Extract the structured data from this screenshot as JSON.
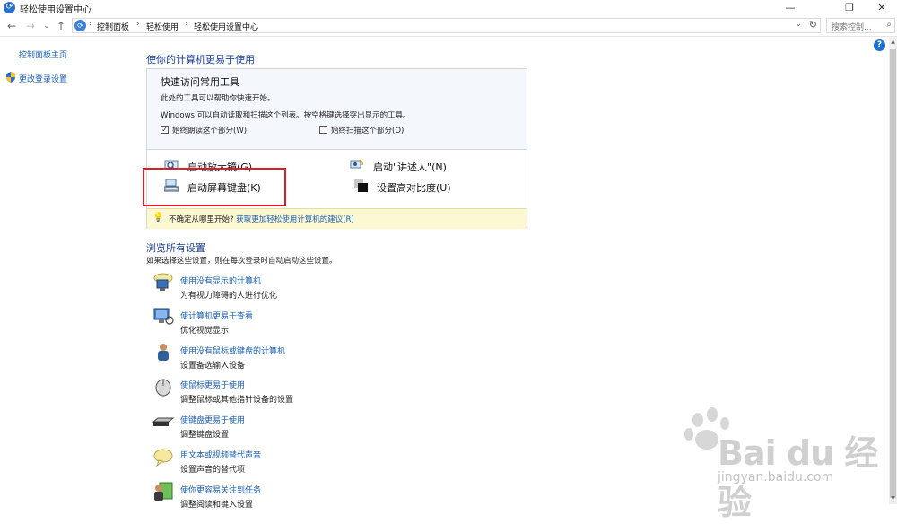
{
  "window": {
    "title": "轻松使用设置中心",
    "minimize": "—",
    "restore": "❐",
    "close": "✕"
  },
  "nav": {
    "back": "←",
    "forward": "→",
    "dropdown": "⌄",
    "up": "↑"
  },
  "breadcrumb": [
    "控制面板",
    "轻松使用",
    "轻松使用设置中心"
  ],
  "search": {
    "placeholder": "搜索控制..."
  },
  "sidebar": {
    "home": "控制面板主页",
    "login": "更改登录设置"
  },
  "main": {
    "title": "使你的计算机更易于使用",
    "quick": {
      "title": "快速访问常用工具",
      "line1": "此处的工具可以帮助你快速开始。",
      "line2": "Windows 可以自动读取和扫描这个列表。按空格键选择突出显示的工具。",
      "cb_read": "始终朗读这个部分(W)",
      "cb_read_checked": true,
      "cb_scan": "始终扫描这个部分(O)",
      "cb_scan_checked": false,
      "tools": {
        "magnifier": "启动放大镜(G)",
        "narrator": "启动\"讲述人\"(N)",
        "keyboard": "启动屏幕键盘(K)",
        "contrast": "设置高对比度(U)"
      },
      "hint_prefix": "不确定从哪里开始?",
      "hint_link": "获取更加轻松使用计算机的建议(R)"
    },
    "browse": {
      "title": "浏览所有设置",
      "subtitle": "如果选择这些设置，则在每次登录时自动启动这些设置。",
      "items": [
        {
          "link": "使用没有显示的计算机",
          "desc": "为有视力障碍的人进行优化"
        },
        {
          "link": "使计算机更易于查看",
          "desc": "优化视觉显示"
        },
        {
          "link": "使用没有鼠标或键盘的计算机",
          "desc": "设置备选输入设备"
        },
        {
          "link": "使鼠标更易于使用",
          "desc": "调整鼠标或其他指针设备的设置"
        },
        {
          "link": "使键盘更易于使用",
          "desc": "调整键盘设置"
        },
        {
          "link": "用文本或视频替代声音",
          "desc": "设置声音的替代项"
        },
        {
          "link": "使你更容易关注到任务",
          "desc": "调整阅读和键入设置"
        }
      ]
    }
  },
  "watermark": {
    "brand": "Bai du 经验",
    "url": "jingyan.baidu.com"
  },
  "colors": {
    "link": "#1a5fb4",
    "heading": "#1a3d9a",
    "highlight": "#e51b24",
    "hint_bg": "#fcf8d2"
  }
}
